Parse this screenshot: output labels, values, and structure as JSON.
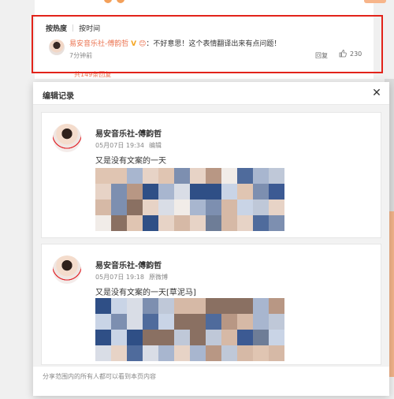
{
  "feed": {
    "sort_tabs": [
      "按热度",
      "按时间"
    ],
    "comment": {
      "user": "易安音乐社-傅韵哲",
      "text": "：不好意思！这个表情翻译出来有点问题！",
      "time": "7分钟前",
      "reply_label": "回复",
      "likes": "230"
    },
    "total_replies": "共149条回复"
  },
  "dialog": {
    "title": "编辑记录",
    "close_icon": "close-icon",
    "records": [
      {
        "user": "易安音乐社-傅韵哲",
        "time": "05月07日 19:34",
        "tag": "编辑",
        "text": "又是没有文案的一天"
      },
      {
        "user": "易安音乐社-傅韵哲",
        "time": "05月07日 19:18",
        "tag": "原微博",
        "text": "又是没有文案的一天[草泥马]"
      }
    ],
    "footer": "分享范围内的所有人都可以看到本页内容"
  },
  "colors": {
    "accent": "#eb7350",
    "highlight": "#e2231a"
  }
}
